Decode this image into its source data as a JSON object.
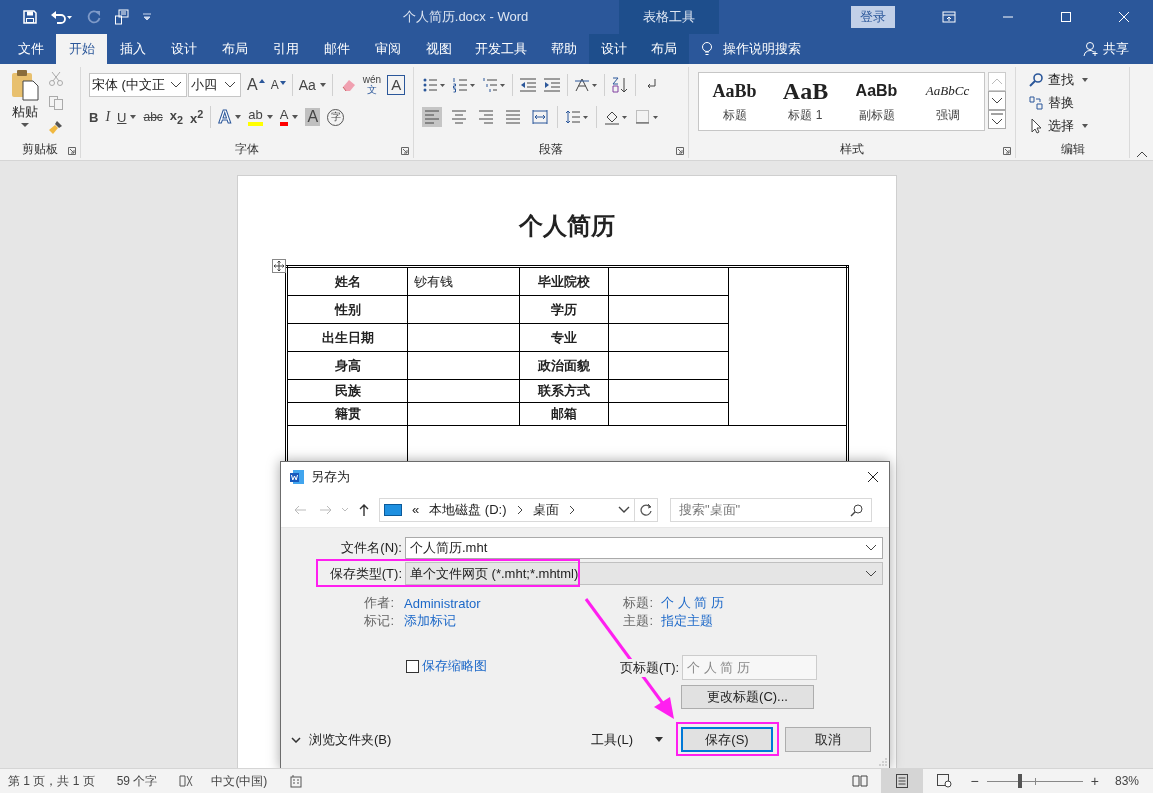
{
  "window": {
    "title": "个人简历.docx  -  Word",
    "context_group": "表格工具",
    "login": "登录"
  },
  "tabs": [
    {
      "label": "文件",
      "selected": false,
      "context": false
    },
    {
      "label": "开始",
      "selected": true,
      "context": false
    },
    {
      "label": "插入",
      "selected": false,
      "context": false
    },
    {
      "label": "设计",
      "selected": false,
      "context": false
    },
    {
      "label": "布局",
      "selected": false,
      "context": false
    },
    {
      "label": "引用",
      "selected": false,
      "context": false
    },
    {
      "label": "邮件",
      "selected": false,
      "context": false
    },
    {
      "label": "审阅",
      "selected": false,
      "context": false
    },
    {
      "label": "视图",
      "selected": false,
      "context": false
    },
    {
      "label": "开发工具",
      "selected": false,
      "context": false
    },
    {
      "label": "帮助",
      "selected": false,
      "context": false
    },
    {
      "label": "设计",
      "selected": false,
      "context": true
    },
    {
      "label": "布局",
      "selected": false,
      "context": true
    }
  ],
  "tell_me": "操作说明搜索",
  "share": "共享",
  "ribbon": {
    "clipboard": {
      "paste": "粘贴",
      "label": "剪贴板"
    },
    "font": {
      "name": "宋体 (中文正",
      "size": "小四",
      "label": "字体",
      "row1": [
        {
          "kind": "grow",
          "text": "A"
        },
        {
          "kind": "shrink",
          "text": "A"
        },
        {
          "kind": "case",
          "text": "Aa"
        },
        {
          "kind": "phonetic",
          "text": "wén",
          "sub": "文"
        },
        {
          "kind": "boxed",
          "text": "A"
        }
      ],
      "row2": [
        {
          "kind": "bold",
          "text": "B"
        },
        {
          "kind": "italic",
          "text": "I"
        },
        {
          "kind": "underline",
          "text": "U"
        },
        {
          "kind": "strike",
          "text": "abc"
        },
        {
          "kind": "script",
          "text": "x$_{2}$"
        },
        {
          "kind": "script",
          "text": "x$^{2}$"
        },
        {
          "kind": "effects",
          "text": "A"
        },
        {
          "kind": "highlight",
          "text": "ab"
        },
        {
          "kind": "color",
          "text": "A"
        },
        {
          "kind": "shade",
          "text": "A"
        },
        {
          "kind": "enclose",
          "text": "字"
        }
      ]
    },
    "paragraph": {
      "label": "段落",
      "alignments": [
        {
          "selected": true
        },
        {
          "selected": false
        },
        {
          "selected": false
        },
        {
          "selected": false
        },
        {
          "selected": false
        }
      ]
    },
    "styles": {
      "label": "样式",
      "items": [
        {
          "sample": "AaBb",
          "label": "标题",
          "kind": "title"
        },
        {
          "sample": "AaB",
          "label": "标题 1",
          "kind": "heading"
        },
        {
          "sample": "AaBb",
          "label": "副标题",
          "kind": "subtitle"
        },
        {
          "sample": "AaBbCc",
          "label": "强调",
          "kind": "emphasis"
        }
      ]
    },
    "editing": {
      "label": "编辑",
      "items": [
        {
          "label": "查找",
          "kind": "find"
        },
        {
          "label": "替换",
          "kind": "replace"
        },
        {
          "label": "选择",
          "kind": "select"
        }
      ]
    }
  },
  "document": {
    "title": "个人简历",
    "rows": [
      {
        "label1": "姓名",
        "value1": "钞有钱",
        "label2": "毕业院校"
      },
      {
        "label1": "性别",
        "label2": "学历"
      },
      {
        "label1": "出生日期",
        "label2": "专业"
      },
      {
        "label1": "身高",
        "label2": "政治面貌"
      },
      {
        "label1": "民族",
        "label2": "联系方式"
      },
      {
        "label1": "籍贯",
        "label2": "邮箱"
      }
    ]
  },
  "dialog": {
    "title": "另存为",
    "path": [
      "本地磁盘 (D:)",
      "桌面"
    ],
    "path_prefix": "«",
    "search_placeholder": "搜索\"桌面\"",
    "filename_label": "文件名(N):",
    "filename": "个人简历.mht",
    "type_label": "保存类型(T):",
    "type": "单个文件网页 (*.mht;*.mhtml)",
    "meta_left": [
      {
        "label": "作者:",
        "value": "Administrator"
      },
      {
        "label": "标记:",
        "value": "添加标记"
      }
    ],
    "meta_right": [
      {
        "label": "标题:",
        "value": "个 人 简 历"
      },
      {
        "label": "主题:",
        "value": "指定主题"
      }
    ],
    "thumbnail": {
      "label": "保存缩略图",
      "checked": false
    },
    "page_title_label": "页标题(T):",
    "page_title": "个 人 简 历",
    "change_title": "更改标题(C)...",
    "browse": "浏览文件夹(B)",
    "tools": "工具(L)",
    "save": "保存(S)",
    "cancel": "取消"
  },
  "status_bar": {
    "page": "第 1 页，共 1 页",
    "words": "59 个字",
    "language": "中文(中国)",
    "views": [
      {
        "kind": "read",
        "selected": false
      },
      {
        "kind": "print",
        "selected": true
      },
      {
        "kind": "web",
        "selected": false
      }
    ],
    "zoom_minus": "−",
    "zoom_plus": "+",
    "zoom": {
      "level": 0.35
    },
    "zoom_text": "83%"
  }
}
